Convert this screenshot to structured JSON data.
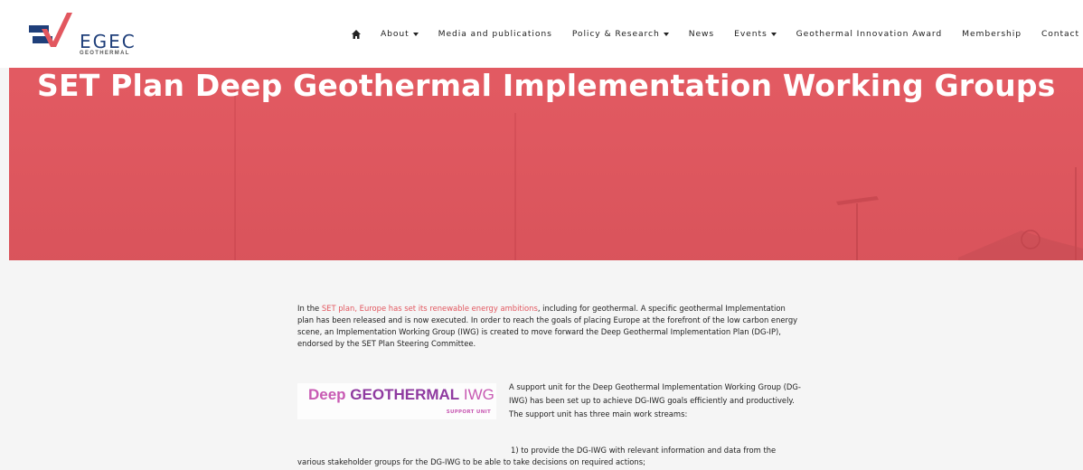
{
  "brand": {
    "name": "EGEC",
    "tagline": "GEOTHERMAL",
    "colors": {
      "primary_red": "#e2575f",
      "navy": "#1f3f7a",
      "iwg_pink": "#c85ab3",
      "iwg_purple": "#8f3aa0"
    }
  },
  "nav": {
    "home_icon": "home-icon",
    "items": [
      {
        "label": "About",
        "dropdown": true
      },
      {
        "label": "Media and publications",
        "dropdown": false
      },
      {
        "label": "Policy & Research",
        "dropdown": true
      },
      {
        "label": "News",
        "dropdown": false
      },
      {
        "label": "Events",
        "dropdown": true
      },
      {
        "label": "Geothermal Innovation Award",
        "dropdown": false
      },
      {
        "label": "Membership",
        "dropdown": false
      },
      {
        "label": "Contact",
        "dropdown": false
      }
    ]
  },
  "hero": {
    "title": "SET Plan Deep Geothermal Implementation Working Groups"
  },
  "content": {
    "p1_prefix": "In the ",
    "p1_link": "SET plan, Europe has set its renewable energy ambitions",
    "p1_suffix": ", including for geothermal. A specific geothermal Implementation plan has been released and is now executed. In order to reach the goals of placing Europe at the forefront of the low carbon energy scene, an Implementation Working Group (IWG) is created to move forward the Deep Geothermal Implementation Plan (DG-IP), endorsed by the SET Plan Steering Committee.",
    "banner": {
      "word1": "Deep ",
      "word2": "GEOTHERMAL",
      "word3": " IWG",
      "sub": "SUPPORT UNIT"
    },
    "p2": "A support unit for the Deep Geothermal Implementation Working Group (DG-IWG) has been set up to achieve DG-IWG goals efficiently and productively. The support unit has three main work streams:",
    "p3_line1": "1) to provide the DG-IWG with relevant information and data from the",
    "p3_line2": "various stakeholder groups for the DG-IWG to be able to take decisions on required actions;"
  }
}
